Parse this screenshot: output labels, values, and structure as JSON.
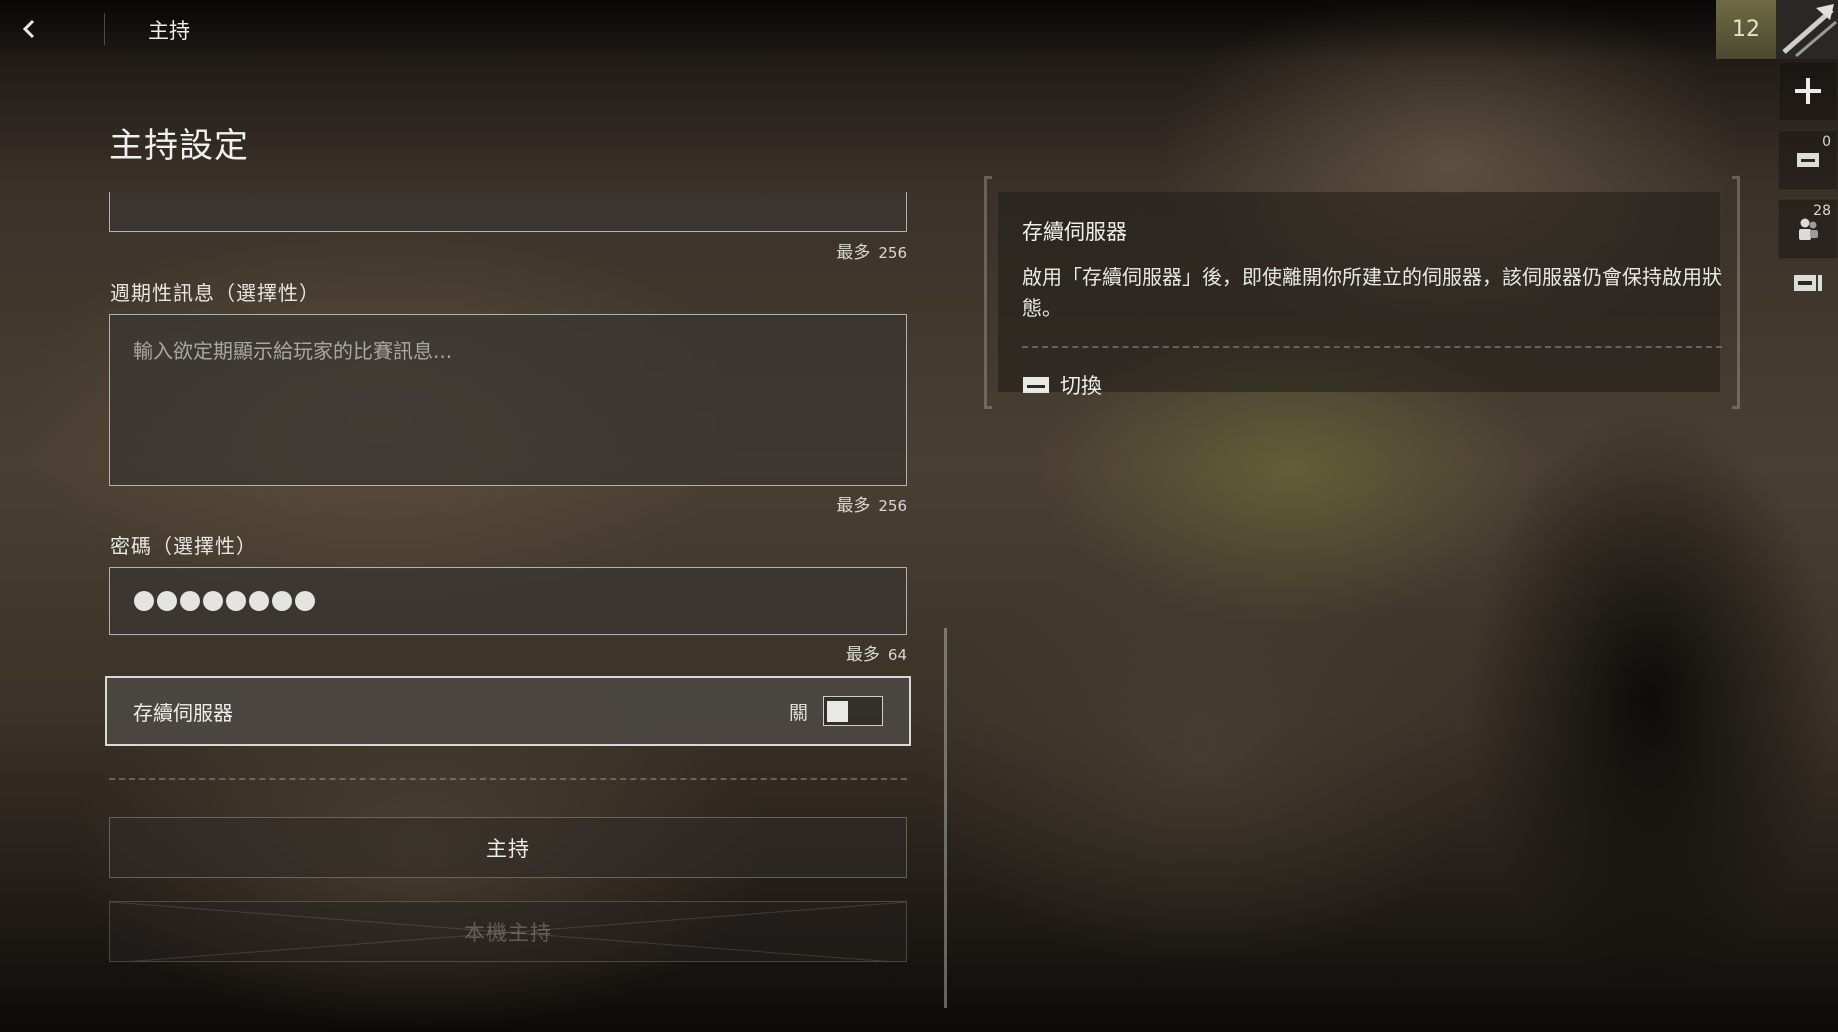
{
  "header": {
    "title": "主持"
  },
  "page": {
    "title": "主持設定"
  },
  "fields": {
    "top_field_max": {
      "label": "最多",
      "value": "256"
    },
    "periodic_message": {
      "label": "週期性訊息（選擇性）",
      "placeholder": "輸入欲定期顯示給玩家的比賽訊息...",
      "max_label": "最多",
      "max_value": "256"
    },
    "password": {
      "label": "密碼（選擇性）",
      "masked_length": 8,
      "max_label": "最多",
      "max_value": "64"
    }
  },
  "persistent_server": {
    "label": "存續伺服器",
    "state": "關",
    "enabled": false
  },
  "buttons": {
    "host": "主持",
    "local_host": "本機主持"
  },
  "info_panel": {
    "title": "存續伺服器",
    "description": "啟用「存續伺服器」後，即使離開你所建立的伺服器，該伺服器仍會保持啟用狀態。",
    "action_label": "切換",
    "action_icon": "keyboard-key-icon"
  },
  "sidebar": {
    "rank": "12",
    "add_icon": "plus-icon",
    "mail_count": "0",
    "friends_count": "28",
    "exit_icon": "exit-icon"
  },
  "colors": {
    "rank_badge": "#6e6a45",
    "panel_bg": "#3a3632",
    "toggle_border": "#d9d9d4"
  }
}
